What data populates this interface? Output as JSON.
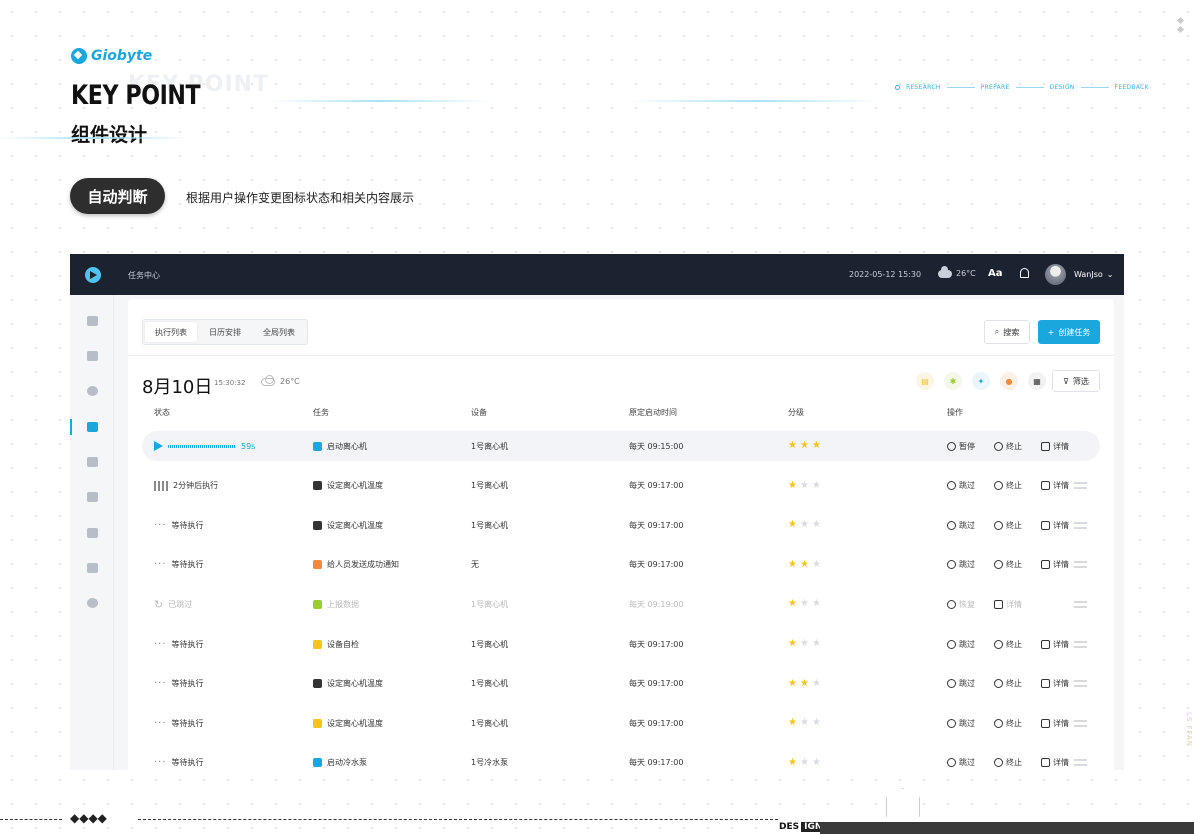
{
  "brand": {
    "name": "Giobyte",
    "headline": "KEY POINT",
    "headline_shadow": "KEY POINT",
    "subtitle": "组件设计"
  },
  "steps": [
    "RESEARCH",
    "PREPARE",
    "DESIGN",
    "FEEDBACK"
  ],
  "feature": {
    "pill": "自动判断",
    "desc": "根据用户操作变更图标状态和相关内容展示"
  },
  "topbar": {
    "title": "任务中心",
    "datetime": "2022-05-12  15:30",
    "weather": "26°C",
    "font_label": "Aa",
    "user": "WanJso"
  },
  "tabs": [
    {
      "label": "执行列表",
      "active": true
    },
    {
      "label": "日历安排",
      "active": false
    },
    {
      "label": "全局列表",
      "active": false
    }
  ],
  "actions": {
    "search": "搜索",
    "create": "创建任务",
    "filter": "筛选"
  },
  "day": {
    "date": "8月10日",
    "time": "15:30:32",
    "weather": "26°C"
  },
  "columns": {
    "status": "状态",
    "task": "任务",
    "device": "设备",
    "time": "原定启动时间",
    "level": "分级",
    "ops": "操作"
  },
  "rows": [
    {
      "status": "59s",
      "status_type": "playing",
      "task": "启动离心机",
      "icon_color": "#1aa7de",
      "device": "1号离心机",
      "time": "每天  09:15:00",
      "stars": 3,
      "ops": [
        "暂停",
        "终止",
        "详情"
      ],
      "muted": false
    },
    {
      "status": "2分钟后执行",
      "status_type": "bars",
      "task": "设定离心机温度",
      "icon_color": "#333",
      "device": "1号离心机",
      "time": "每天  09:17:00",
      "stars": 1,
      "ops": [
        "跳过",
        "终止",
        "详情"
      ],
      "muted": false
    },
    {
      "status": "等待执行",
      "status_type": "dots",
      "task": "设定离心机温度",
      "icon_color": "#333",
      "device": "1号离心机",
      "time": "每天  09:17:00",
      "stars": 1,
      "ops": [
        "跳过",
        "终止",
        "详情"
      ],
      "muted": false
    },
    {
      "status": "等待执行",
      "status_type": "dots",
      "task": "给人员发送成功通知",
      "icon_color": "#f08a3c",
      "device": "无",
      "time": "每天  09:17:00",
      "stars": 2,
      "ops": [
        "跳过",
        "终止",
        "详情"
      ],
      "muted": false
    },
    {
      "status": "已跳过",
      "status_type": "skipped",
      "task": "上报数据",
      "icon_color": "#9acd32",
      "device": "1号离心机",
      "time": "每天  09:19:00",
      "stars": 1,
      "ops": [
        "恢复",
        "详情"
      ],
      "muted": true
    },
    {
      "status": "等待执行",
      "status_type": "dots",
      "task": "设备自检",
      "icon_color": "#f5c518",
      "device": "1号离心机",
      "time": "每天  09:17:00",
      "stars": 1,
      "ops": [
        "跳过",
        "终止",
        "详情"
      ],
      "muted": false
    },
    {
      "status": "等待执行",
      "status_type": "dots",
      "task": "设定离心机温度",
      "icon_color": "#333",
      "device": "1号离心机",
      "time": "每天  09:17:00",
      "stars": 2,
      "ops": [
        "跳过",
        "终止",
        "详情"
      ],
      "muted": false
    },
    {
      "status": "等待执行",
      "status_type": "dots",
      "task": "设定离心机温度",
      "icon_color": "#f5c518",
      "device": "1号离心机",
      "time": "每天  09:17:00",
      "stars": 1,
      "ops": [
        "跳过",
        "终止",
        "详情"
      ],
      "muted": false
    },
    {
      "status": "等待执行",
      "status_type": "dots",
      "task": "启动冷水泵",
      "icon_color": "#1aa7de",
      "device": "1号冷水泵",
      "time": "每天  09:17:00",
      "stars": 1,
      "ops": [
        "跳过",
        "终止",
        "详情"
      ],
      "muted": false
    }
  ],
  "footer": {
    "design_a": "DES",
    "design_b": "IGN",
    "diamonds": "◆◆◆◆",
    "side_tag": "LS FFAN"
  }
}
